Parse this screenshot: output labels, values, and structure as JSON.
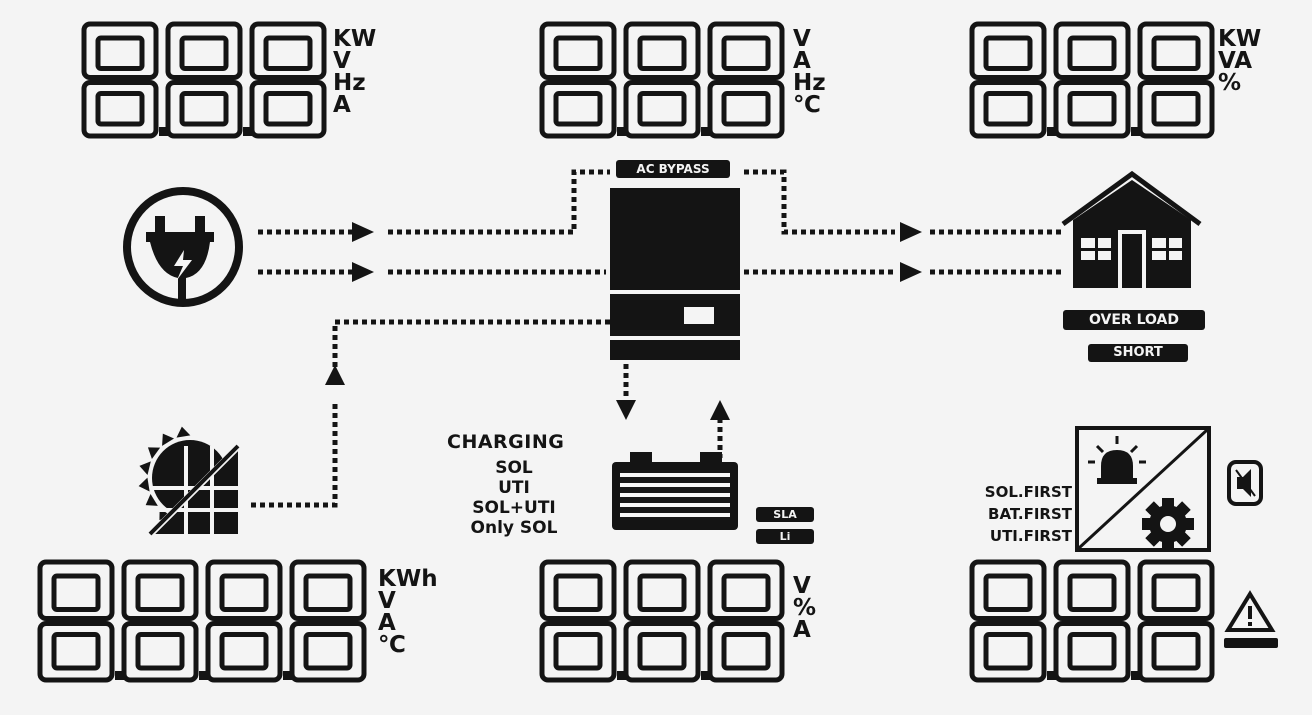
{
  "display": {
    "top_left": {
      "digits": "888",
      "units": [
        "KW",
        "V",
        "Hz",
        "A"
      ]
    },
    "top_center": {
      "digits": "888",
      "units": [
        "V",
        "A",
        "Hz",
        "℃"
      ]
    },
    "top_right": {
      "digits": "888",
      "units": [
        "KW",
        "VA",
        "%"
      ]
    },
    "bottom_left": {
      "digits": "8888",
      "units": [
        "KWh",
        "V",
        "A",
        "℃"
      ]
    },
    "bottom_center": {
      "digits": "888",
      "units": [
        "V",
        "%",
        "A"
      ]
    },
    "bottom_right": {
      "digits": "888"
    }
  },
  "badges": {
    "ac_bypass": "AC BYPASS",
    "over_load": "OVER LOAD",
    "short": "SHORT",
    "sla": "SLA",
    "li": "Li"
  },
  "charging": {
    "title": "CHARGING",
    "modes": [
      "SOL",
      "UTI",
      "SOL+UTI",
      "Only SOL"
    ]
  },
  "priority": [
    "SOL.FIRST",
    "BAT.FIRST",
    "UTI.FIRST"
  ],
  "icons": {
    "grid": "plug-icon",
    "solar": "solar-panel-icon",
    "inverter": "inverter-icon",
    "battery": "battery-icon",
    "load": "house-icon",
    "buzzer": "speaker-mute-icon",
    "warning": "warning-icon",
    "bulb": "bulb-icon",
    "gear": "gear-icon"
  },
  "colors": {
    "segment": "#141414",
    "background": "#f4f4f4"
  }
}
